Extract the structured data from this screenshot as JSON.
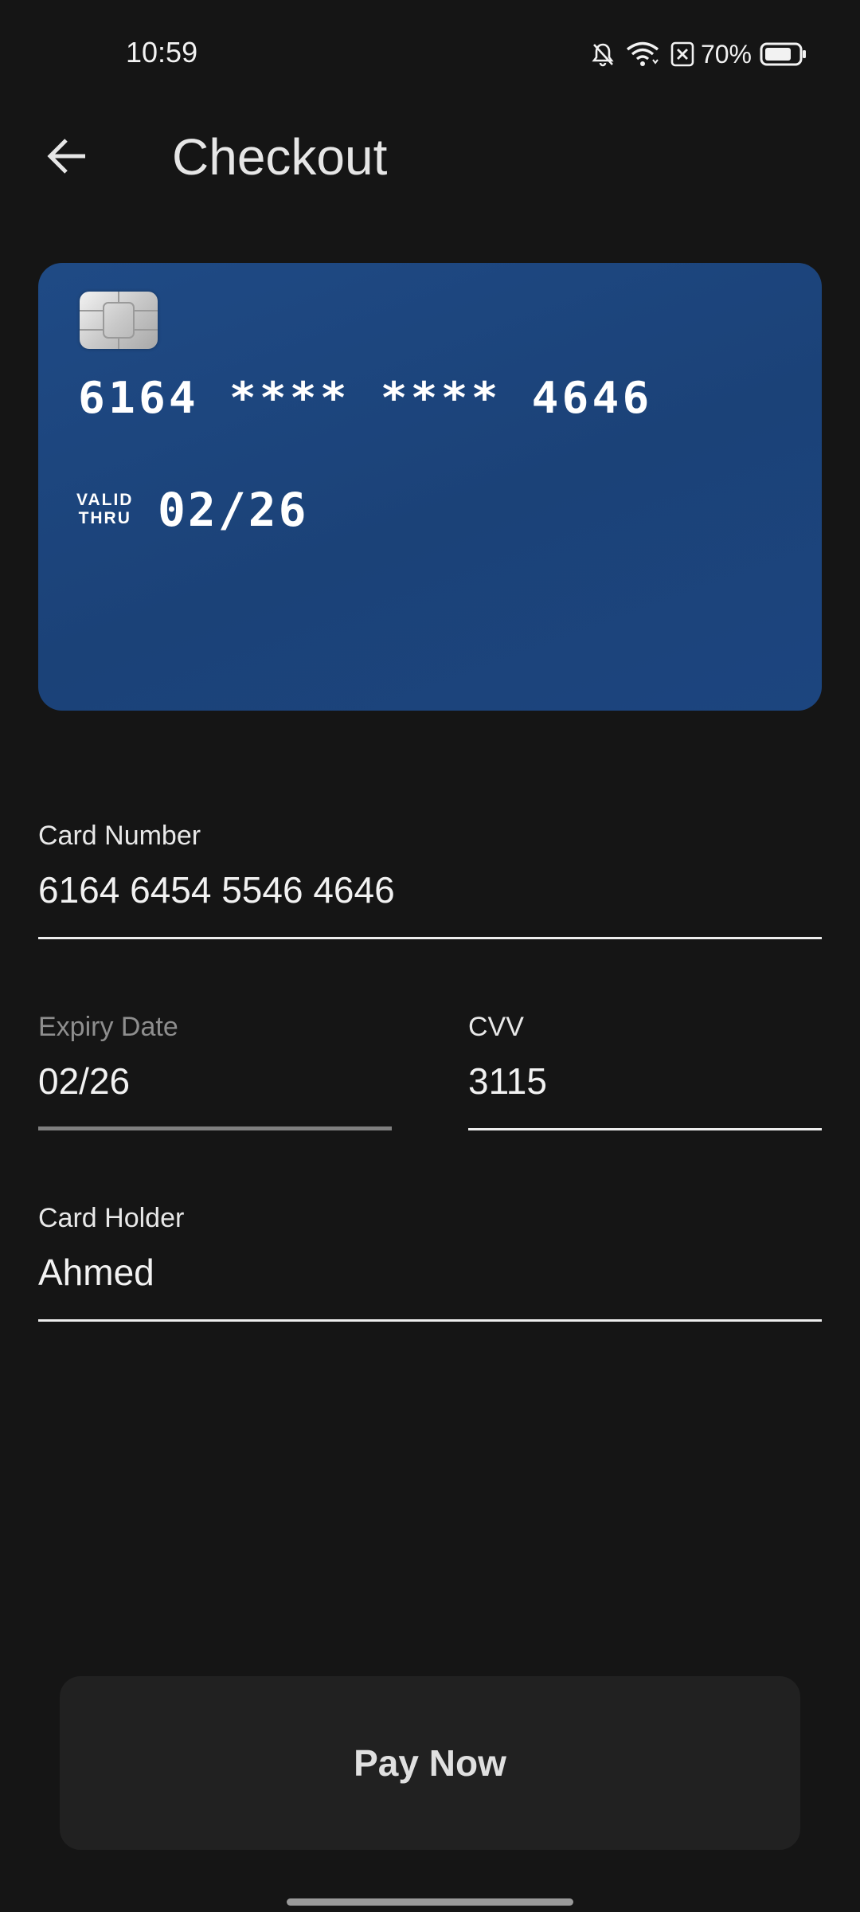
{
  "status_bar": {
    "time": "10:59",
    "battery_percent": "70%",
    "icons": [
      "bell-off-icon",
      "wifi-icon",
      "sim-off-icon",
      "battery-icon"
    ]
  },
  "app_bar": {
    "title": "Checkout",
    "back_icon": "arrow-left-icon"
  },
  "card_preview": {
    "number": "6164 **** **** 4646",
    "valid_thru_line1": "VALID",
    "valid_thru_line2": "THRU",
    "expiry": "02/26",
    "background_color": "#1d4580"
  },
  "form": {
    "card_number": {
      "label": "Card Number",
      "value": "6164 6454 5546 4646"
    },
    "expiry_date": {
      "label": "Expiry Date",
      "value": "02/26"
    },
    "cvv": {
      "label": "CVV",
      "value": "3115"
    },
    "card_holder": {
      "label": "Card Holder",
      "value": "Ahmed"
    }
  },
  "pay_button": {
    "label": "Pay Now"
  },
  "colors": {
    "background": "#151515",
    "card": "#1d4580",
    "button": "#212121"
  }
}
